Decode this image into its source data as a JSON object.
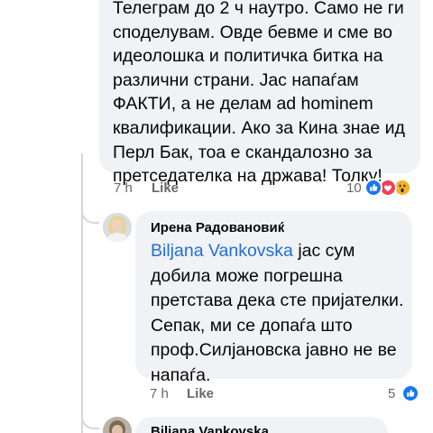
{
  "comment1": {
    "lines": [
      "Телеграм до 2 ч наутро. Само не ги",
      "споделувам. Овде бевме и сме во",
      "идеолошка и политичка битка на",
      "различни страни. Јас напаѓам",
      "ФАКТИ, а не делам ad hominem",
      "квалификации. Ако за Кина знае ид",
      "Перл Бак, тоа е скандалозно за",
      "претседателка на држава! Толку!"
    ],
    "time": "7 h",
    "like_label": "Like",
    "reaction_count": "10",
    "reactions": [
      "like-icon",
      "love-icon",
      "wow-icon"
    ]
  },
  "comment2": {
    "author": "Ирена Радовановиќ",
    "mention": "Biljana Vankovska",
    "first_line_rest": " јас сум",
    "lines": [
      "добила може погрешна",
      "претстава дека сте пријателки.",
      "Сепак, ми се допаѓа што",
      "проф.Силјановска јавно не ве",
      "напаѓа."
    ],
    "time": "7 h",
    "like_label": "Like",
    "reaction_count": "5",
    "reactions": [
      "like-icon"
    ]
  },
  "comment3": {
    "author": "Biljana Vankovska"
  },
  "colors": {
    "bubble": "#f0f2f5",
    "mention": "#216fdb",
    "meta": "#65676b",
    "like_blue": "#1877f2",
    "love_red": "#f33e58",
    "wow_yellow": "#f7b125"
  }
}
